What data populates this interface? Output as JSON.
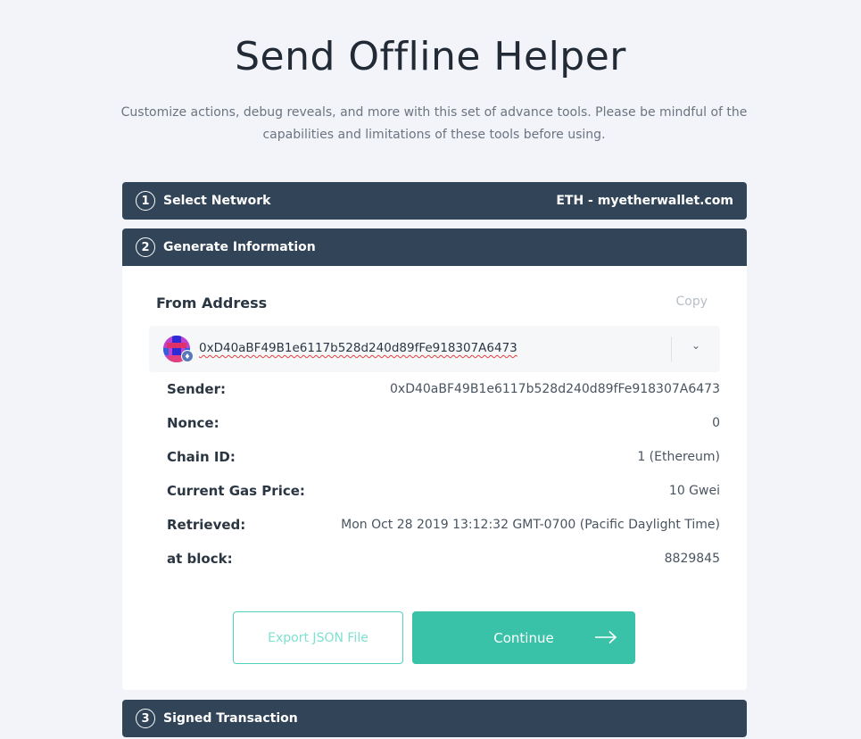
{
  "page": {
    "title": "Send Offline Helper",
    "subtitle": "Customize actions, debug reveals, and more with this set of advance tools. Please be mindful of the capabilities and limitations of these tools before using."
  },
  "steps": [
    {
      "number": "1",
      "label": "Select Network",
      "value": "ETH - myetherwallet.com"
    },
    {
      "number": "2",
      "label": "Generate Information"
    },
    {
      "number": "3",
      "label": "Signed Transaction"
    }
  ],
  "generate": {
    "from_label": "From Address",
    "copy_label": "Copy",
    "selected_address": "0xD40aBF49B1e6117b528d240d89fFe918307A6473",
    "info": [
      {
        "key": "Sender:",
        "value": "0xD40aBF49B1e6117b528d240d89fFe918307A6473"
      },
      {
        "key": "Nonce:",
        "value": "0"
      },
      {
        "key": "Chain ID:",
        "value": "1 (Ethereum)"
      },
      {
        "key": "Current Gas Price:",
        "value": "10 Gwei"
      },
      {
        "key": "Retrieved:",
        "value": "Mon Oct 28 2019 13:12:32 GMT-0700 (Pacific Daylight Time)"
      },
      {
        "key": "at block:",
        "value": "8829845"
      }
    ],
    "export_label": "Export JSON File",
    "continue_label": "Continue"
  },
  "colors": {
    "header_bar": "#324458",
    "accent": "#3ac2a8",
    "background": "#f2f4fa"
  },
  "icons": {
    "address_avatar": "blockie-avatar-icon",
    "network_badge": "ethereum-icon",
    "dropdown": "chevron-down-icon",
    "continue_arrow": "arrow-right-icon"
  }
}
